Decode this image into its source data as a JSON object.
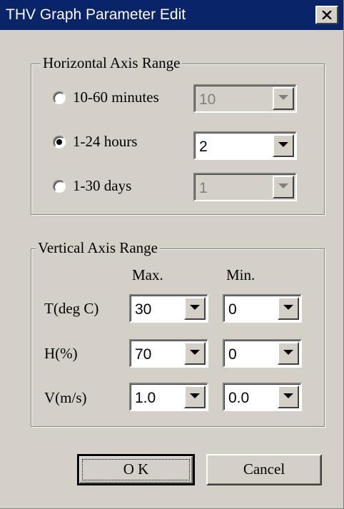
{
  "window": {
    "title": "THV Graph Parameter Edit",
    "close_label": "×"
  },
  "horizontal": {
    "group_title": "Horizontal Axis Range",
    "options": [
      {
        "label": "10-60 minutes",
        "checked": false,
        "value": "10",
        "enabled": false
      },
      {
        "label": "1-24 hours",
        "checked": true,
        "value": "2",
        "enabled": true
      },
      {
        "label": "1-30 days",
        "checked": false,
        "value": "1",
        "enabled": false
      }
    ]
  },
  "vertical": {
    "group_title": "Vertical Axis Range",
    "max_header": "Max.",
    "min_header": "Min.",
    "rows": [
      {
        "label": "T(deg C)",
        "max": "30",
        "min": "0"
      },
      {
        "label": "H(%)",
        "max": "70",
        "min": "0"
      },
      {
        "label": "V(m/s)",
        "max": "1.0",
        "min": "0.0"
      }
    ]
  },
  "buttons": {
    "ok": "O K",
    "cancel": "Cancel"
  }
}
